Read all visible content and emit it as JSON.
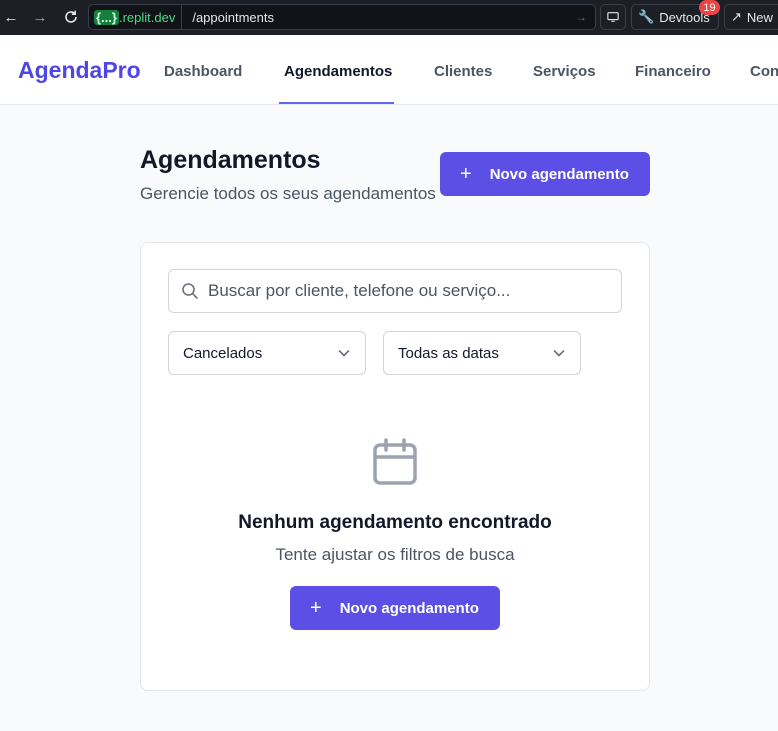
{
  "browser": {
    "url_host_brace": "{...}",
    "url_host_domain": ".replit.dev",
    "url_path": "/appointments",
    "devtools_label": "Devtools",
    "devtools_badge": "19",
    "new_tab_label": "New"
  },
  "app": {
    "logo": "AgendaPro",
    "nav": [
      {
        "label": "Dashboard"
      },
      {
        "label": "Agendamentos"
      },
      {
        "label": "Clientes"
      },
      {
        "label": "Serviços"
      },
      {
        "label": "Financeiro"
      },
      {
        "label": "Con"
      }
    ],
    "active_nav": "Agendamentos"
  },
  "page": {
    "title": "Agendamentos",
    "subtitle": "Gerencie todos os seus agendamentos",
    "new_button_icon": "+",
    "new_button_label": "Novo agendamento"
  },
  "filters": {
    "search_placeholder": "Buscar por cliente, telefone ou serviço...",
    "search_value": "",
    "status_selected": "Cancelados",
    "date_selected": "Todas as datas"
  },
  "empty_state": {
    "title": "Nenhum agendamento encontrado",
    "subtitle": "Tente ajustar os filtros de busca",
    "button_icon": "+",
    "button_label": "Novo agendamento"
  },
  "colors": {
    "accent": "#5b4fe6",
    "logo": "#4f46e5",
    "chrome_bg": "#1c1f26"
  }
}
